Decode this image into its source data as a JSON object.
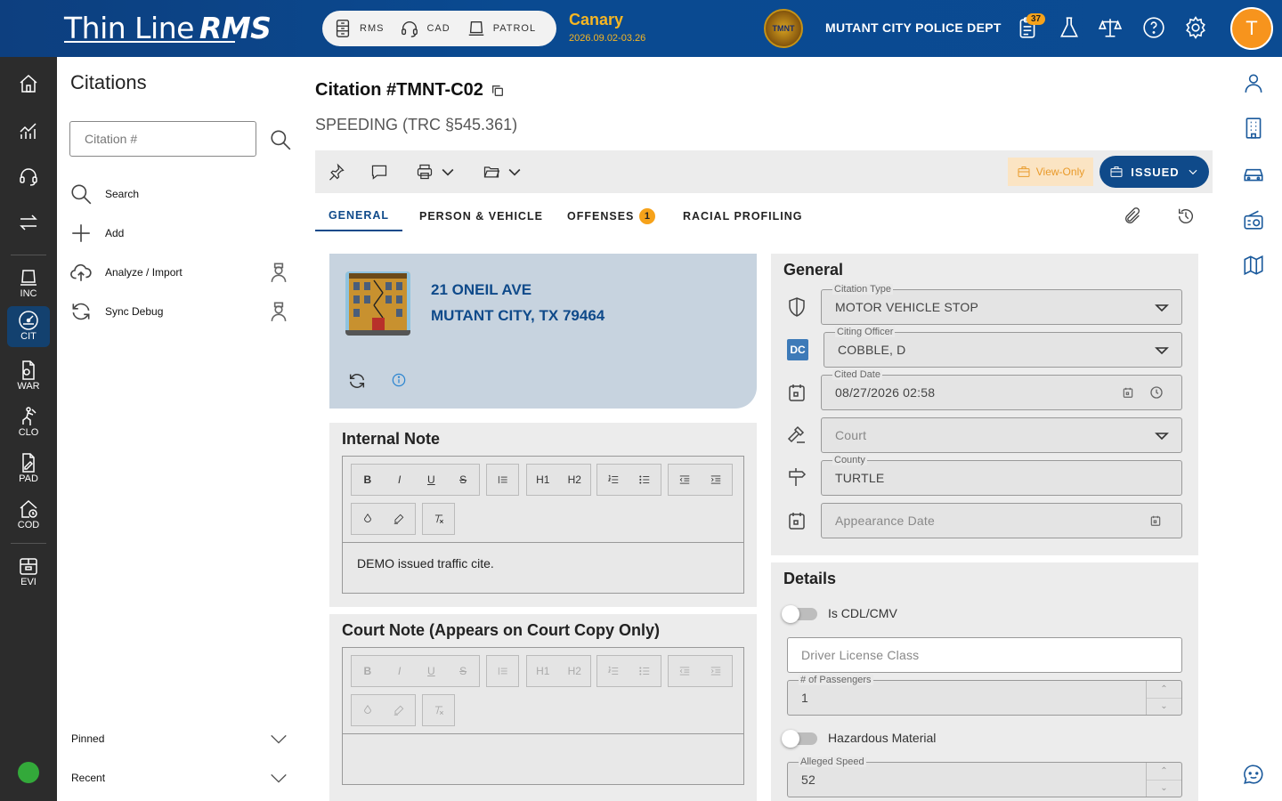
{
  "app": {
    "logo_text": "Thin Line",
    "logo_suffix": "RMS",
    "modules": [
      {
        "label": "RMS",
        "icon": "file-cabinet-icon"
      },
      {
        "label": "CAD",
        "icon": "headset-icon"
      },
      {
        "label": "PATROL",
        "icon": "patrol-laptop-icon"
      }
    ],
    "environment": "Canary",
    "version": "2026.09.02-03.26",
    "badge_text": "TMNT",
    "department": "MUTANT CITY POLICE DEPT",
    "notification_count": "37",
    "user_initial": "T",
    "accent_color": "#0f4a8a",
    "warning_color": "#f6a21a"
  },
  "rail": {
    "items": [
      {
        "label": "",
        "icon": "home-icon"
      },
      {
        "label": "",
        "icon": "analytics-icon"
      },
      {
        "label": "",
        "icon": "headset-icon"
      },
      {
        "label": "",
        "icon": "transfer-icon"
      },
      {
        "label": "INC",
        "icon": "incident-icon"
      },
      {
        "label": "CIT",
        "icon": "citation-gauge-icon"
      },
      {
        "label": "WAR",
        "icon": "warrant-icon"
      },
      {
        "label": "CLO",
        "icon": "climber-icon"
      },
      {
        "label": "PAD",
        "icon": "pad-icon"
      },
      {
        "label": "COD",
        "icon": "code-house-icon"
      },
      {
        "label": "EVI",
        "icon": "evidence-box-icon"
      }
    ],
    "status": "online"
  },
  "side": {
    "title": "Citations",
    "search_placeholder": "Citation #",
    "actions": [
      {
        "label": "Search",
        "icon": "search-icon"
      },
      {
        "label": "Add",
        "icon": "plus-icon"
      },
      {
        "label": "Analyze / Import",
        "icon": "cloud-upload-icon"
      },
      {
        "label": "Sync Debug",
        "icon": "sync-icon"
      }
    ],
    "pinned": "Pinned",
    "recent": "Recent"
  },
  "citation": {
    "title": "Citation #TMNT-C02",
    "subtitle": "SPEEDING (TRC §545.361)",
    "view_only": "View-Only",
    "status": "ISSUED"
  },
  "tabs": [
    {
      "label": "GENERAL",
      "active": true
    },
    {
      "label": "PERSON & VEHICLE",
      "active": false
    },
    {
      "label": "OFFENSES",
      "active": false,
      "count": "1"
    },
    {
      "label": "RACIAL PROFILING",
      "active": false
    }
  ],
  "address": {
    "line1": "21 ONEIL AVE",
    "line2": "MUTANT CITY, TX 79464"
  },
  "internal_note": {
    "title": "Internal Note",
    "text": "DEMO issued traffic cite."
  },
  "court_note": {
    "title": "Court Note (Appears on Court Copy Only)",
    "text": ""
  },
  "editor_buttons": [
    "B",
    "I",
    "U",
    "S",
    "H1",
    "H2"
  ],
  "general": {
    "heading": "General",
    "citation_type": {
      "label": "Citation Type",
      "value": "MOTOR VEHICLE STOP"
    },
    "citing_officer": {
      "label": "Citing Officer",
      "value": "COBBLE, D",
      "initials": "DC"
    },
    "cited_date": {
      "label": "Cited Date",
      "value": "08/27/2026 02:58"
    },
    "court": {
      "placeholder": "Court"
    },
    "county": {
      "label": "County",
      "value": "TURTLE"
    },
    "appearance_date": {
      "placeholder": "Appearance Date"
    }
  },
  "details": {
    "heading": "Details",
    "is_cdl": {
      "label": "Is CDL/CMV",
      "on": false
    },
    "driver_license_class": {
      "placeholder": "Driver License Class"
    },
    "passengers": {
      "label": "# of Passengers",
      "value": "1"
    },
    "hazardous": {
      "label": "Hazardous Material",
      "on": false
    },
    "alleged_speed": {
      "label": "Alleged Speed",
      "value": "52"
    }
  }
}
